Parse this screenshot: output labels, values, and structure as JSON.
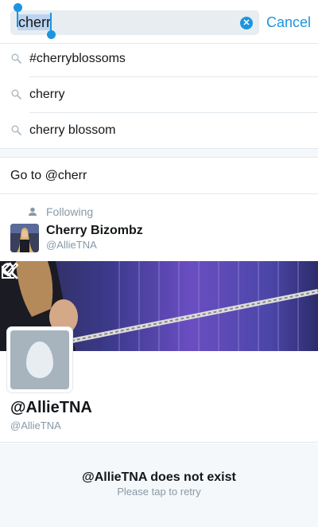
{
  "search": {
    "query": "cherr",
    "cancel_label": "Cancel"
  },
  "suggestions": [
    {
      "label": "#cherryblossoms"
    },
    {
      "label": "cherry"
    },
    {
      "label": "cherry blossom"
    }
  ],
  "goto": {
    "label": "Go to @cherr"
  },
  "following": {
    "label": "Following",
    "user_name": "Cherry Bizombz",
    "user_handle": "@AllieTNA"
  },
  "profile": {
    "name": "@AllieTNA",
    "handle": "@AllieTNA"
  },
  "error": {
    "title": "@AllieTNA does not exist",
    "subtitle": "Please tap to retry"
  },
  "icons": {
    "clear": "clear-icon",
    "search": "magnifier-icon",
    "back": "chevron-left-icon",
    "compose": "compose-icon",
    "following": "person-icon"
  },
  "colors": {
    "accent": "#1b95e0",
    "text": "#14171a",
    "muted": "#8899a6",
    "divider": "#e1e8ed"
  }
}
